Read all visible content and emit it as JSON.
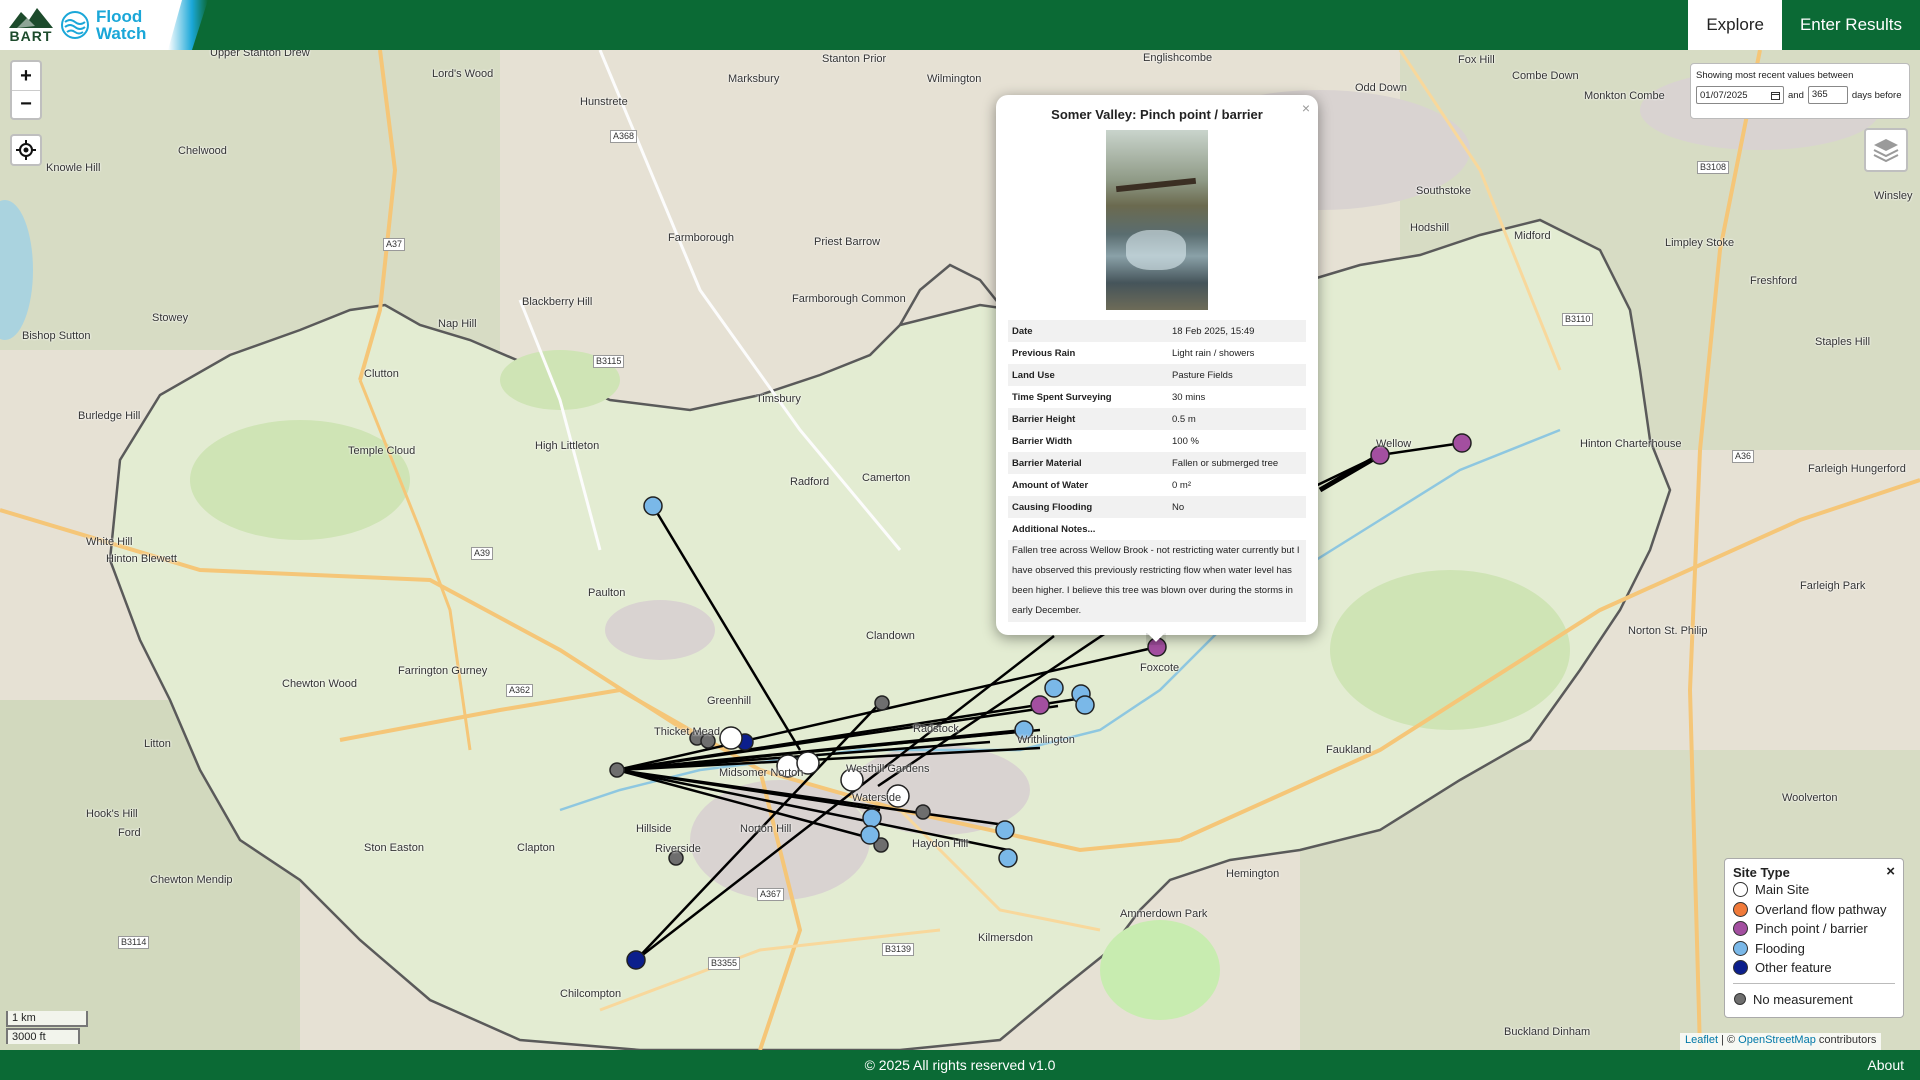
{
  "header": {
    "logo_text": "BART",
    "app_name_line1": "Flood",
    "app_name_line2": "Watch",
    "nav": [
      {
        "label": "Explore",
        "active": true
      },
      {
        "label": "Enter Results",
        "active": false
      }
    ]
  },
  "map_controls": {
    "zoom_in": "+",
    "zoom_out": "−",
    "date_filter_text": "Showing most recent values between",
    "date_value": "01/07/2025",
    "and_text": "and",
    "days_value": "365",
    "days_before_text": "days before"
  },
  "place_labels": [
    "Upper Stanton Drew",
    "Marksbury",
    "Stanton Prior",
    "Wilmington",
    "Englishcombe",
    "Odd Down",
    "Fox Hill",
    "Combe Down",
    "Monkton Combe",
    "Chelwood",
    "Hunstrete",
    "Knowle Hill",
    "Stowey",
    "Farmborough",
    "Priest Barrow",
    "Southstoke",
    "Hodshill",
    "Midford",
    "Limpley Stoke",
    "Freshford",
    "Bishop Sutton",
    "Nap Hill",
    "Blackberry Hill",
    "Farmborough Common",
    "Clutton",
    "Timsbury",
    "Burledge Hill",
    "Temple Cloud",
    "High Littleton",
    "Radford",
    "Camerton",
    "Wellow",
    "Hinton Charterhouse",
    "White Hill",
    "Hinton Blewett",
    "Paulton",
    "Clandown",
    "Farrington Gurney",
    "Greenhill",
    "Foxcote",
    "Norton St. Philip",
    "Chewton Wood",
    "Litton",
    "Thicket Mead",
    "Midsomer Norton",
    "Westhill Gardens",
    "Radstock",
    "Writhlington",
    "Faukland",
    "Hillside",
    "Riverside",
    "Norton Hill",
    "Haydon Hill",
    "Hemington",
    "Woolverton",
    "Hook's Hill",
    "Ford",
    "Ston Easton",
    "Clapton",
    "Chewton Mendip",
    "Kilmersdon",
    "Ammerdown Park",
    "Chilcompton",
    "Buckland Dinham",
    "Winsley",
    "Staples Hill",
    "Farleigh Hungerford",
    "Farleigh Park",
    "Waterside",
    "Lord's Wood"
  ],
  "road_labels": [
    "A368",
    "A37",
    "B3115",
    "A39",
    "A362",
    "A367",
    "B3139",
    "B3355",
    "B3114",
    "B3110",
    "A36",
    "B3108"
  ],
  "popup": {
    "title": "Somer Valley: Pinch point / barrier",
    "photo_alt": "Photo of fallen tree across Wellow Brook",
    "close": "×",
    "rows": [
      {
        "key": "Date",
        "value": "18 Feb 2025, 15:49"
      },
      {
        "key": "Previous Rain",
        "value": "Light rain / showers"
      },
      {
        "key": "Land Use",
        "value": "Pasture Fields"
      },
      {
        "key": "Time Spent Surveying",
        "value": "30 mins"
      },
      {
        "key": "Barrier Height",
        "value": "0.5 m"
      },
      {
        "key": "Barrier Width",
        "value": "100 %"
      },
      {
        "key": "Barrier Material",
        "value": "Fallen or submerged tree"
      },
      {
        "key": "Amount of Water",
        "value": "0 m²"
      },
      {
        "key": "Causing Flooding",
        "value": "No"
      },
      {
        "key": "Additional Notes...",
        "value": ""
      }
    ],
    "notes": "Fallen tree across Wellow Brook - not restricting water currently but I have observed this previously restricting flow when water level has been higher. I believe this tree was blown over during the storms in early December."
  },
  "legend": {
    "title": "Site Type",
    "close": "×",
    "items": [
      {
        "label": "Main Site",
        "color": "#ffffff"
      },
      {
        "label": "Overland flow pathway",
        "color": "#f07a3a"
      },
      {
        "label": "Pinch point / barrier",
        "color": "#a34fa0"
      },
      {
        "label": "Flooding",
        "color": "#7ab8e8"
      },
      {
        "label": "Other feature",
        "color": "#0c1f8c"
      }
    ],
    "no_measurement": {
      "label": "No measurement",
      "color": "#6e6e6e"
    }
  },
  "scale": {
    "metric": "1 km",
    "imperial": "3000 ft"
  },
  "attribution": {
    "leaflet": "Leaflet",
    "sep": " | © ",
    "osm": "OpenStreetMap",
    "suffix": " contributors"
  },
  "footer": {
    "copyright": "© 2025 All rights reserved v1.0",
    "about": "About"
  },
  "colors": {
    "brand_green": "#0b6a35",
    "accent_blue": "#1aa7d8",
    "catchment_fill": "#d8eec0",
    "boundary": "#555555"
  }
}
